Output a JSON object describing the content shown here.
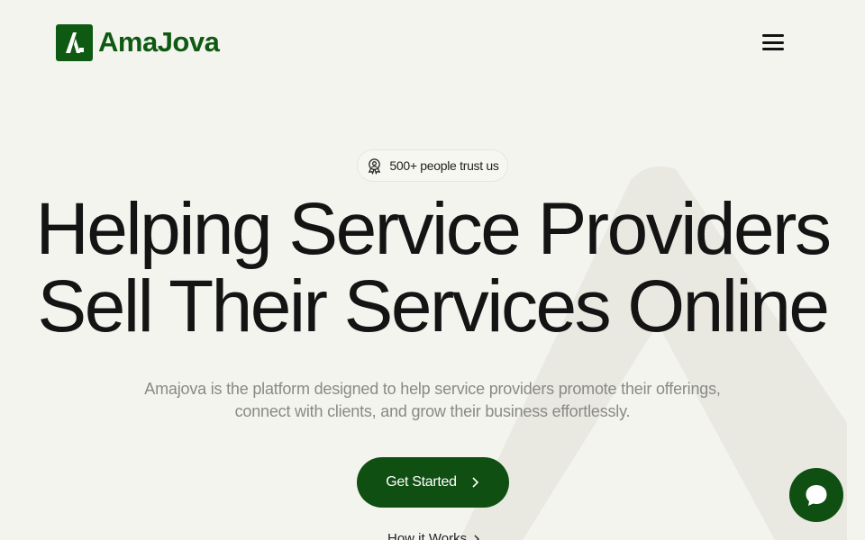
{
  "brand": {
    "name": "AmaJova",
    "accent_color": "#0f5a12"
  },
  "header": {
    "menu_icon": "hamburger-menu-icon"
  },
  "hero": {
    "trust_badge": "500+ people trust us",
    "trust_icon": "badge-person-icon",
    "title_line_1": "Helping Service Providers",
    "title_line_2": "Sell Their Services Online",
    "subtitle_line_1": "Amajova is the platform designed to help service providers promote their offerings,",
    "subtitle_line_2": "connect with clients, and grow their business effortlessly.",
    "cta_label": "Get Started",
    "cta_icon": "chevron-right-icon",
    "secondary_link": "How it Works"
  },
  "chat": {
    "icon": "chat-bubble-icon",
    "color": "#0f4f12"
  }
}
